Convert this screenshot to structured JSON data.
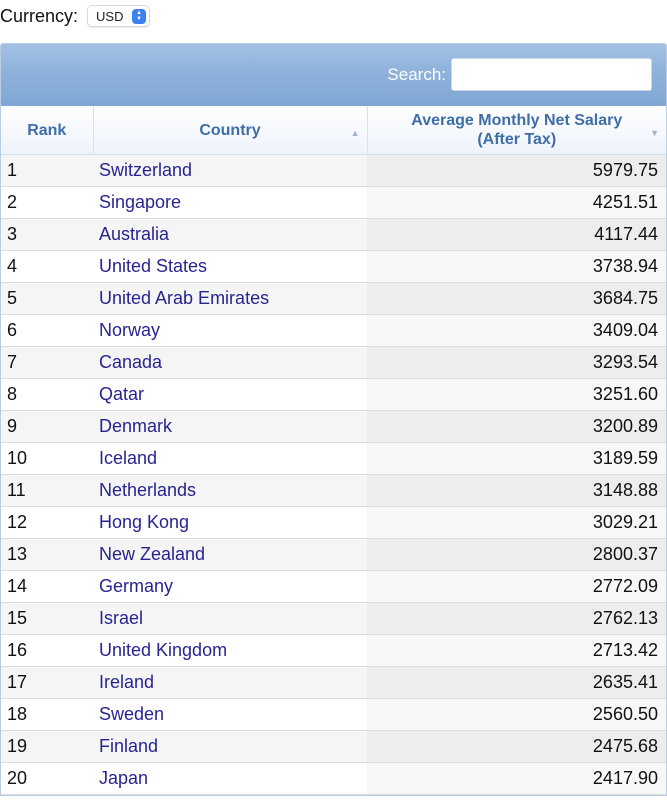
{
  "currency": {
    "label": "Currency:",
    "selected": "USD"
  },
  "toolbar": {
    "search_label": "Search:",
    "search_value": ""
  },
  "columns": [
    {
      "label": "Rank"
    },
    {
      "label": "Country",
      "sort": "ascending-indicator"
    },
    {
      "label": "Average Monthly Net Salary",
      "label2": "(After Tax)",
      "sort": "descending-indicator"
    }
  ],
  "rows": [
    {
      "rank": "1",
      "country": "Switzerland",
      "salary": "5979.75"
    },
    {
      "rank": "2",
      "country": "Singapore",
      "salary": "4251.51"
    },
    {
      "rank": "3",
      "country": "Australia",
      "salary": "4117.44"
    },
    {
      "rank": "4",
      "country": "United States",
      "salary": "3738.94"
    },
    {
      "rank": "5",
      "country": "United Arab Emirates",
      "salary": "3684.75"
    },
    {
      "rank": "6",
      "country": "Norway",
      "salary": "3409.04"
    },
    {
      "rank": "7",
      "country": "Canada",
      "salary": "3293.54"
    },
    {
      "rank": "8",
      "country": "Qatar",
      "salary": "3251.60"
    },
    {
      "rank": "9",
      "country": "Denmark",
      "salary": "3200.89"
    },
    {
      "rank": "10",
      "country": "Iceland",
      "salary": "3189.59"
    },
    {
      "rank": "11",
      "country": "Netherlands",
      "salary": "3148.88"
    },
    {
      "rank": "12",
      "country": "Hong Kong",
      "salary": "3029.21"
    },
    {
      "rank": "13",
      "country": "New Zealand",
      "salary": "2800.37"
    },
    {
      "rank": "14",
      "country": "Germany",
      "salary": "2772.09"
    },
    {
      "rank": "15",
      "country": "Israel",
      "salary": "2762.13"
    },
    {
      "rank": "16",
      "country": "United Kingdom",
      "salary": "2713.42"
    },
    {
      "rank": "17",
      "country": "Ireland",
      "salary": "2635.41"
    },
    {
      "rank": "18",
      "country": "Sweden",
      "salary": "2560.50"
    },
    {
      "rank": "19",
      "country": "Finland",
      "salary": "2475.68"
    },
    {
      "rank": "20",
      "country": "Japan",
      "salary": "2417.90"
    }
  ]
}
